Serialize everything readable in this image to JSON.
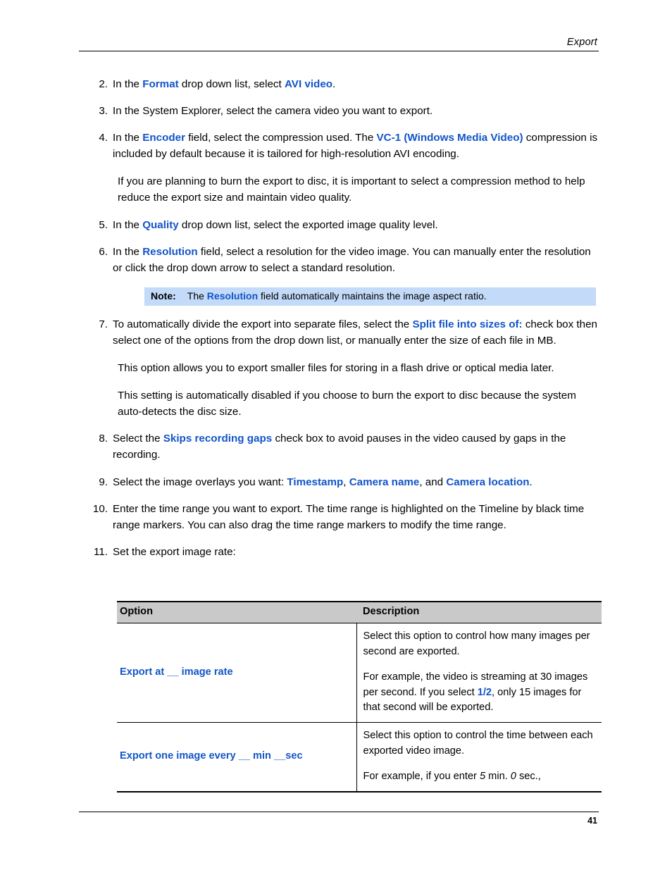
{
  "header": {
    "title": "Export"
  },
  "footer": {
    "page_number": "41"
  },
  "colors": {
    "link_blue": "#1255c8",
    "note_background": "#c3daf8",
    "table_header_background": "#c9c9c9",
    "text": "#000000"
  },
  "steps": [
    {
      "number": "2.",
      "segments": [
        {
          "text": "In the ",
          "style": "normal"
        },
        {
          "text": "Format",
          "style": "keyword"
        },
        {
          "text": " drop down list, select ",
          "style": "normal"
        },
        {
          "text": "AVI video",
          "style": "keyword"
        },
        {
          "text": ".",
          "style": "normal"
        }
      ]
    },
    {
      "number": "3.",
      "segments": [
        {
          "text": "In the System Explorer, select the camera video you want to export.",
          "style": "normal"
        }
      ]
    },
    {
      "number": "4.",
      "segments": [
        {
          "text": "In the ",
          "style": "normal"
        },
        {
          "text": "Encoder",
          "style": "keyword"
        },
        {
          "text": " field, select the compression used. The ",
          "style": "normal"
        },
        {
          "text": "VC-1 (Windows Media Video)",
          "style": "keyword"
        },
        {
          "text": " compression is included by default because it is tailored for high-resolution AVI encoding.",
          "style": "normal"
        }
      ],
      "followups": [
        "If you are planning to burn the export to disc, it is important to select a compression method to help reduce the export size and maintain video quality."
      ]
    },
    {
      "number": "5.",
      "segments": [
        {
          "text": "In the ",
          "style": "normal"
        },
        {
          "text": "Quality",
          "style": "keyword"
        },
        {
          "text": " drop down list, select the exported image quality level.",
          "style": "normal"
        }
      ]
    },
    {
      "number": "6.",
      "segments": [
        {
          "text": "In the ",
          "style": "normal"
        },
        {
          "text": "Resolution",
          "style": "keyword"
        },
        {
          "text": " field, select a resolution for the video image. You can manually enter the resolution or click the drop down arrow to select a standard resolution.",
          "style": "normal"
        }
      ]
    },
    {
      "number": "7.",
      "segments": [
        {
          "text": "To automatically divide the export into separate files, select the ",
          "style": "normal"
        },
        {
          "text": "Split file into sizes of:",
          "style": "keyword"
        },
        {
          "text": " check box then select one of the options from the drop down list, or manually enter the size of each file in MB.",
          "style": "normal"
        }
      ],
      "followups": [
        "This option allows you to export smaller files for storing in a flash drive or optical media later.",
        "This setting is automatically disabled if you choose to burn the export to disc because the system auto-detects the disc size."
      ]
    },
    {
      "number": "8.",
      "segments": [
        {
          "text": "Select the ",
          "style": "normal"
        },
        {
          "text": "Skips recording gaps",
          "style": "keyword"
        },
        {
          "text": " check box to avoid pauses in the video caused by gaps in the recording.",
          "style": "normal"
        }
      ]
    },
    {
      "number": "9.",
      "segments": [
        {
          "text": "Select the image overlays you want: ",
          "style": "normal"
        },
        {
          "text": "Timestamp",
          "style": "keyword"
        },
        {
          "text": ", ",
          "style": "normal"
        },
        {
          "text": "Camera name",
          "style": "keyword"
        },
        {
          "text": ", and ",
          "style": "normal"
        },
        {
          "text": "Camera location",
          "style": "keyword"
        },
        {
          "text": ".",
          "style": "normal"
        }
      ]
    },
    {
      "number": "10.",
      "segments": [
        {
          "text": "Enter the time range you want to export. The time range is highlighted on the Timeline by black time range markers. You can also drag the time range markers to modify the time range.",
          "style": "normal"
        }
      ]
    },
    {
      "number": "11.",
      "segments": [
        {
          "text": "Set the export image rate:",
          "style": "normal"
        }
      ]
    }
  ],
  "note": {
    "label": "Note:",
    "segments": [
      {
        "text": "The ",
        "style": "normal"
      },
      {
        "text": "Resolution",
        "style": "keyword"
      },
      {
        "text": " field automatically maintains the image aspect ratio.",
        "style": "normal"
      }
    ]
  },
  "table": {
    "columns": [
      "Option",
      "Description"
    ],
    "rows": [
      {
        "option": "Export at __  image rate",
        "description_paragraphs": [
          [
            {
              "text": "Select this option to control how many images per second are exported.",
              "style": "normal"
            }
          ],
          [
            {
              "text": "For example, the video is streaming at 30 images per second. If you select ",
              "style": "normal"
            },
            {
              "text": "1/2",
              "style": "keyword"
            },
            {
              "text": ", only 15 images for that second will be exported.",
              "style": "normal"
            }
          ]
        ]
      },
      {
        "option": "Export one image every __  min __sec",
        "description_paragraphs": [
          [
            {
              "text": "Select this option to control the time between each exported video image.",
              "style": "normal"
            }
          ],
          [
            {
              "text": "For example, if you enter ",
              "style": "normal"
            },
            {
              "text": "5",
              "style": "italic"
            },
            {
              "text": " min. ",
              "style": "normal"
            },
            {
              "text": "0",
              "style": "italic"
            },
            {
              "text": " sec.,",
              "style": "normal"
            }
          ]
        ]
      }
    ]
  }
}
